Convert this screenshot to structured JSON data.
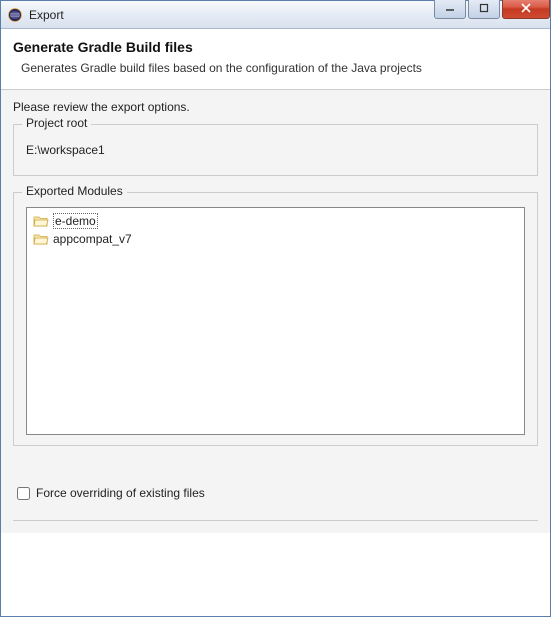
{
  "window": {
    "title": "Export"
  },
  "header": {
    "title": "Generate Gradle Build files",
    "description": "Generates Gradle build files based on the configuration of the Java projects"
  },
  "body": {
    "reviewText": "Please review the export options.",
    "projectRoot": {
      "label": "Project root",
      "value": "E:\\workspace1"
    },
    "exportedModules": {
      "label": "Exported Modules",
      "items": [
        {
          "name": "e-demo",
          "selected": true
        },
        {
          "name": "appcompat_v7",
          "selected": false
        }
      ]
    },
    "forceOverride": {
      "label": "Force overriding of existing files",
      "checked": false
    }
  }
}
